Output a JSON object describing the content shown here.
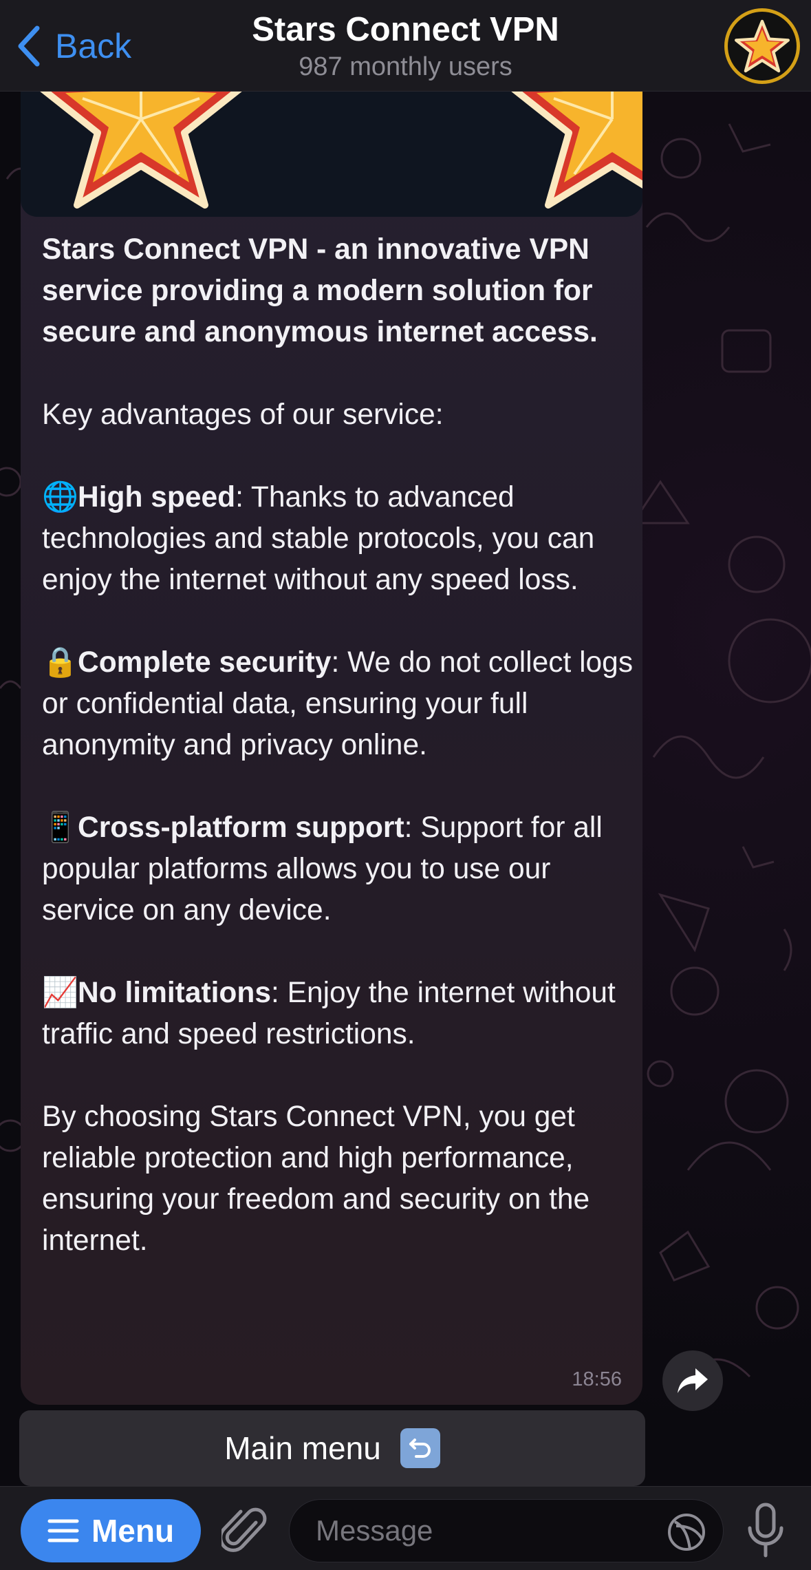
{
  "header": {
    "back_label": "Back",
    "title": "Stars Connect VPN",
    "subtitle": "987 monthly users"
  },
  "message": {
    "intro": "Stars Connect VPN - an innovative VPN service providing a modern solution for secure and anonymous internet access.",
    "advantages_heading": "Key advantages of our service:",
    "features": [
      {
        "emoji": "🌐",
        "icon": "globe-icon",
        "title": "High speed",
        "text": ": Thanks to advanced technologies and stable protocols, you can enjoy the internet without any speed loss."
      },
      {
        "emoji": "🔒",
        "icon": "lock-icon",
        "title": "Complete security",
        "text": ": We do not collect logs or confidential data, ensuring your full anonymity and privacy online."
      },
      {
        "emoji": "📱",
        "icon": "phone-icon",
        "title": "Cross-platform support",
        "text": ": Support for all popular platforms allows you to use our service on any device."
      },
      {
        "emoji": "📈",
        "icon": "chart-icon",
        "title": "No limitations",
        "text": ": Enjoy the internet without traffic and speed restrictions."
      }
    ],
    "closing": "By choosing Stars Connect VPN, you get reliable protection and high performance, ensuring your freedom and security on the internet.",
    "time": "18:56"
  },
  "inline_button": {
    "label": "Main menu",
    "icon": "return-arrow-icon"
  },
  "bottom_bar": {
    "menu_label": "Menu",
    "message_placeholder": "Message"
  },
  "colors": {
    "accent": "#3b86ee",
    "back_link": "#3e8ff0",
    "header_bg": "#1c1b20",
    "bubble_bg": "#25202c",
    "star_gold": "#f7b42c",
    "star_red": "#d8382a"
  }
}
